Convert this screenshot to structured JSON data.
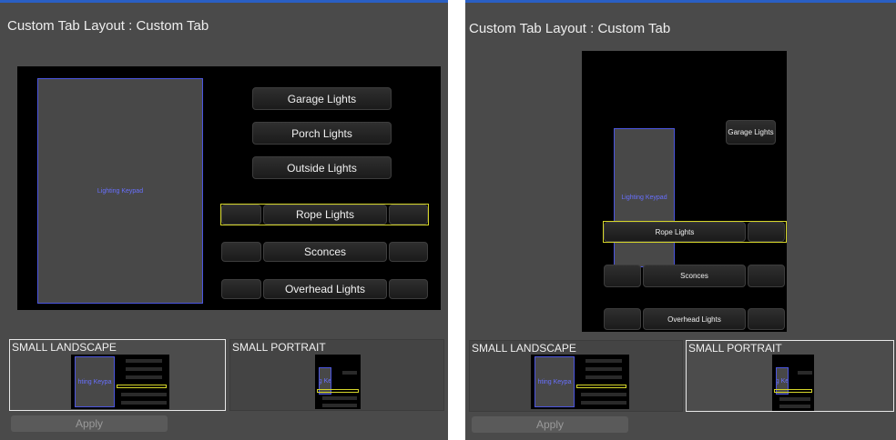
{
  "left_panel": {
    "title": "Custom Tab Layout : Custom Tab",
    "keypad_label": "Lighting Keypad",
    "buttons": [
      "Garage Lights",
      "Porch Lights",
      "Outside Lights",
      "Rope Lights",
      "Sconces",
      "Overhead Lights"
    ],
    "thumbs": {
      "small_landscape": "SMALL LANDSCAPE",
      "small_portrait": "SMALL PORTRAIT",
      "landscape_keypad_text": "hting Keypa",
      "portrait_keypad_text": "g Ke"
    },
    "apply_label": "Apply"
  },
  "right_panel": {
    "title": "Custom Tab Layout : Custom Tab",
    "keypad_label": "Lighting Keypad",
    "buttons": [
      "Garage Lights",
      "Rope Lights",
      "Sconces",
      "Overhead Lights"
    ],
    "thumbs": {
      "small_landscape": "SMALL LANDSCAPE",
      "small_portrait": "SMALL PORTRAIT",
      "landscape_keypad_text": "hting Keypa",
      "portrait_keypad_text": "g Ke"
    },
    "apply_label": "Apply"
  },
  "colors": {
    "panel_bg": "#4a4a4a",
    "canvas_bg": "#000000",
    "keypad_border": "#4b55e0",
    "selection": "#d6d62a",
    "accent_line": "#2a5fc4"
  }
}
